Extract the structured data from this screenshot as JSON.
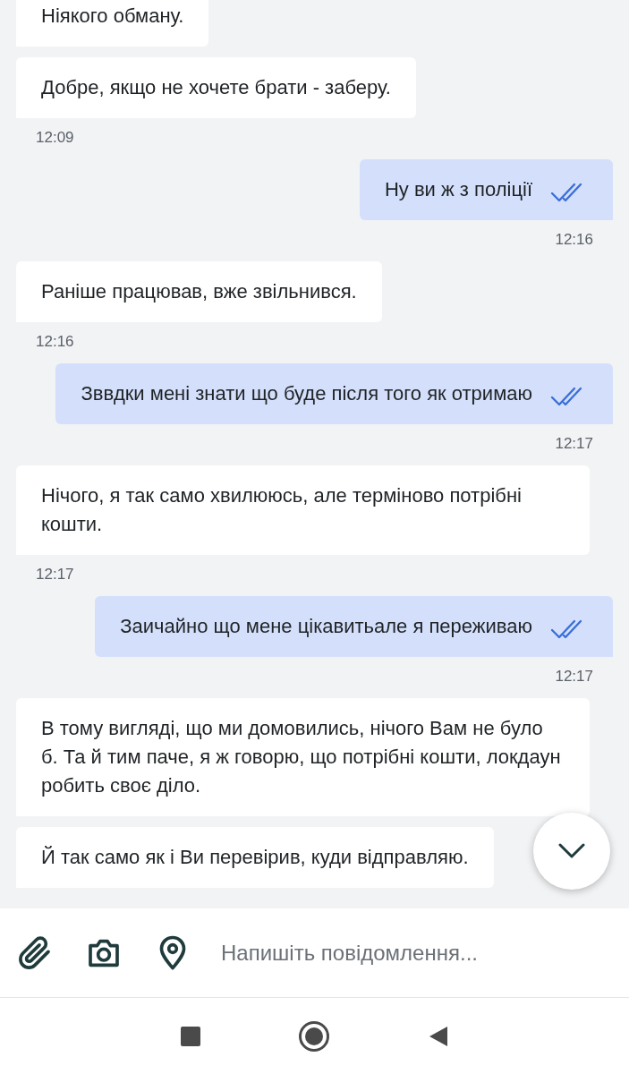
{
  "messages": [
    {
      "kind": "incoming",
      "text": "Ніякого обману."
    },
    {
      "kind": "incoming",
      "text": "Добре, якщо не хочете брати - заберу.",
      "time": "12:09"
    },
    {
      "kind": "outgoing",
      "text": "Ну ви ж з поліції",
      "time": "12:16",
      "read": true
    },
    {
      "kind": "incoming",
      "text": "Раніше працював, вже звільнився.",
      "time": "12:16"
    },
    {
      "kind": "outgoing",
      "text": "Зввдки мені знати що буде після того як отримаю",
      "time": "12:17",
      "read": true
    },
    {
      "kind": "incoming",
      "text": "Нічого, я так само хвилююсь, але терміново потрібні кошти.",
      "time": "12:17"
    },
    {
      "kind": "outgoing",
      "text": "Заичайно що мене цікавитьале я переживаю",
      "time": "12:17",
      "read": true
    },
    {
      "kind": "incoming",
      "text": "В тому вигляді, що ми домовились, нічого Вам не було б. Та й тим паче, я ж говорю, що потрібні кошти, локдаун робить своє діло."
    },
    {
      "kind": "incoming",
      "text": "Й так само як і Ви перевірив, куди відправляю."
    }
  ],
  "composer": {
    "placeholder": "Напишіть повідомлення..."
  }
}
